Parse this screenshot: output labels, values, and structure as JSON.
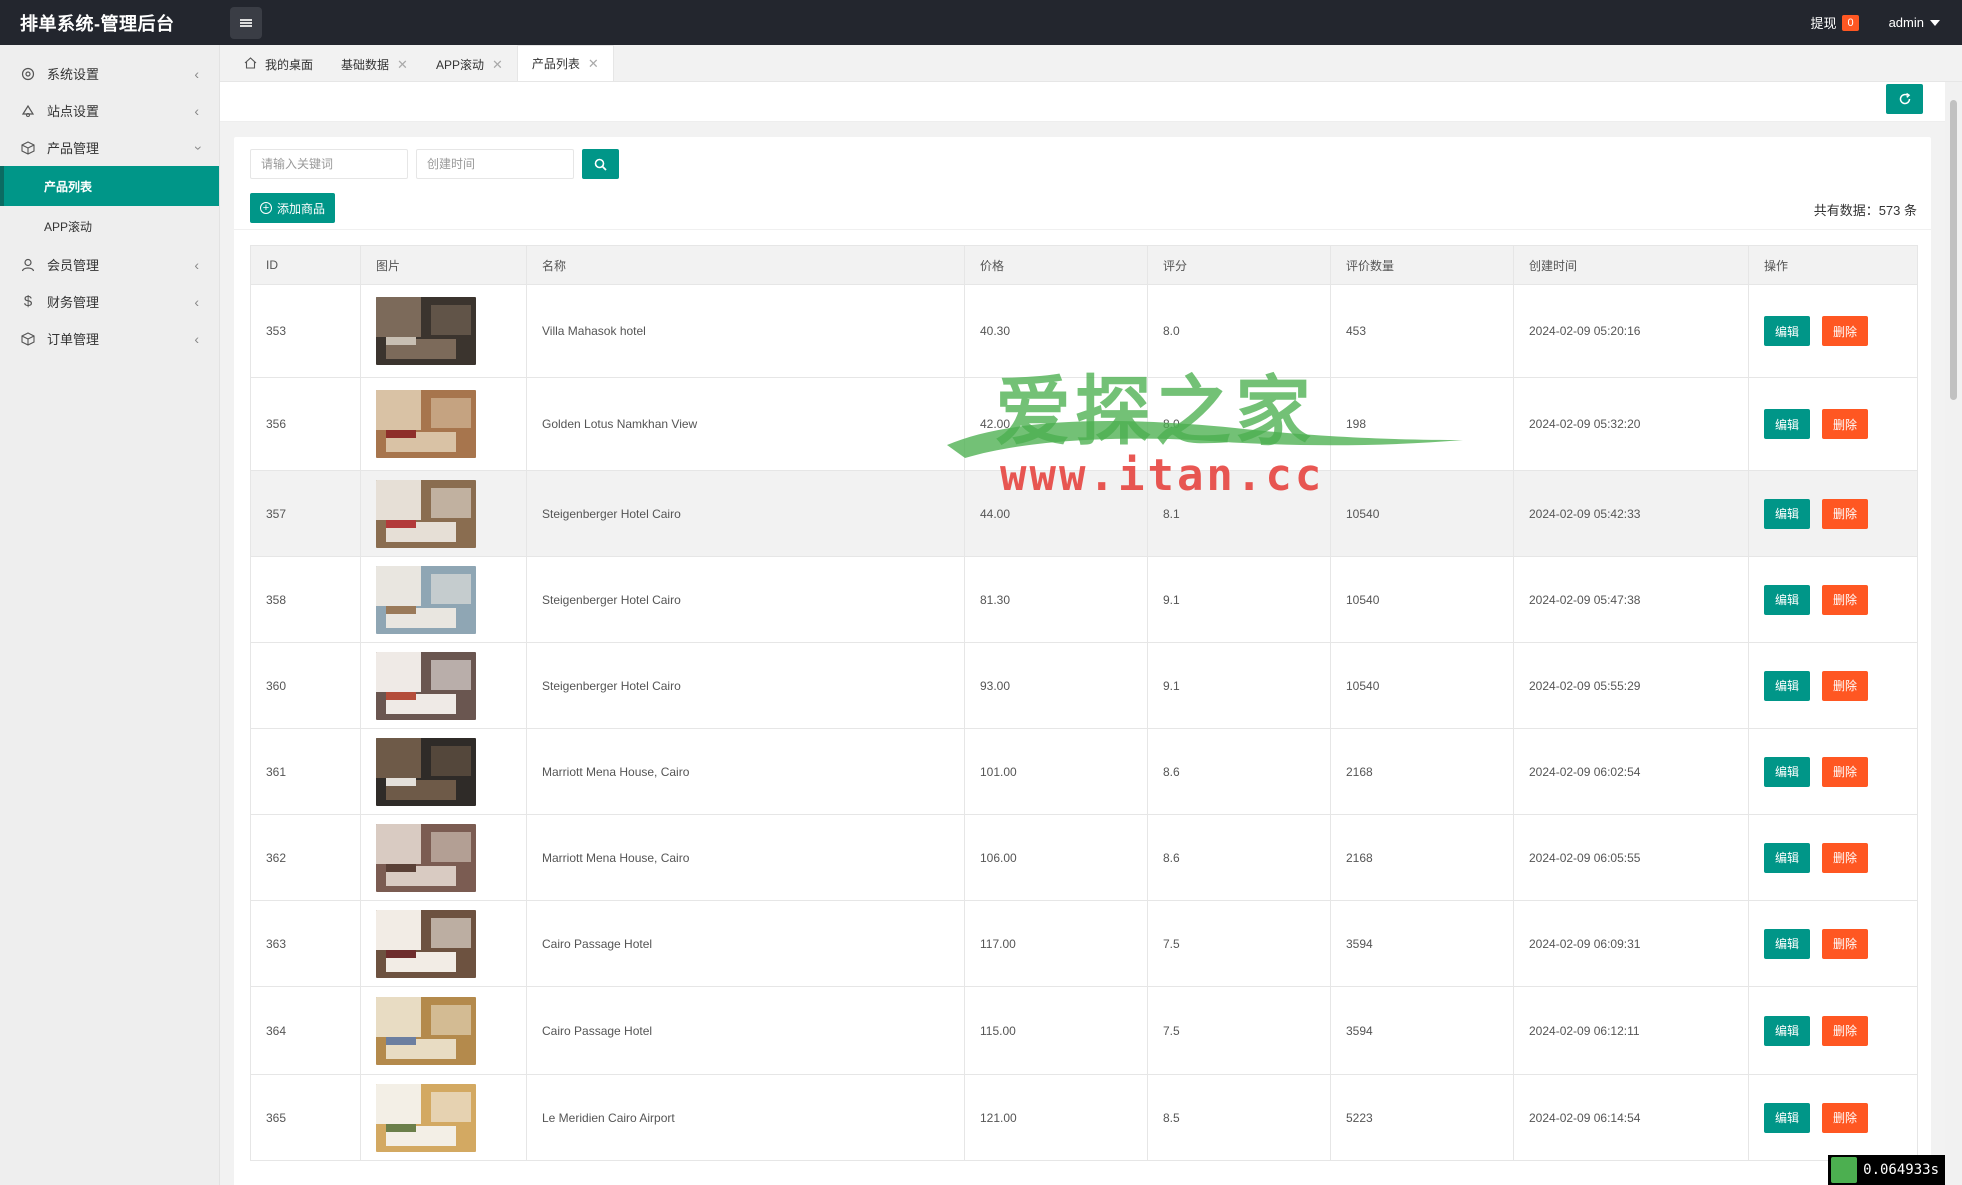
{
  "header": {
    "title": "排单系统-管理后台",
    "withdraw_label": "提现",
    "withdraw_count": "0",
    "user": "admin"
  },
  "sidebar": {
    "items": [
      {
        "label": "系统设置",
        "icon": "gear-icon"
      },
      {
        "label": "站点设置",
        "icon": "site-icon"
      },
      {
        "label": "产品管理",
        "icon": "cube-icon"
      },
      {
        "label": "会员管理",
        "icon": "user-icon"
      },
      {
        "label": "财务管理",
        "icon": "dollar-icon"
      },
      {
        "label": "订单管理",
        "icon": "box-icon"
      }
    ],
    "sub_items": [
      "产品列表",
      "APP滚动"
    ]
  },
  "tabs": [
    {
      "label": "我的桌面"
    },
    {
      "label": "基础数据"
    },
    {
      "label": "APP滚动"
    },
    {
      "label": "产品列表"
    }
  ],
  "search": {
    "keyword_placeholder": "请输入关键词",
    "date_placeholder": "创建时间"
  },
  "actions": {
    "add_label": "添加商品",
    "total_label": "共有数据：573 条",
    "edit_label": "编辑",
    "delete_label": "删除"
  },
  "table": {
    "columns": [
      "ID",
      "图片",
      "名称",
      "价格",
      "评分",
      "评价数量",
      "创建时间",
      "操作"
    ],
    "rows": [
      {
        "id": "353",
        "name": "Villa Mahasok hotel",
        "price": "40.30",
        "score": "8.0",
        "reviews": "453",
        "created": "2024-02-09 05:20:16"
      },
      {
        "id": "356",
        "name": "Golden Lotus Namkhan View",
        "price": "42.00",
        "score": "8.0",
        "reviews": "198",
        "created": "2024-02-09 05:32:20"
      },
      {
        "id": "357",
        "name": "Steigenberger Hotel Cairo",
        "price": "44.00",
        "score": "8.1",
        "reviews": "10540",
        "created": "2024-02-09 05:42:33"
      },
      {
        "id": "358",
        "name": "Steigenberger Hotel Cairo",
        "price": "81.30",
        "score": "9.1",
        "reviews": "10540",
        "created": "2024-02-09 05:47:38"
      },
      {
        "id": "360",
        "name": "Steigenberger Hotel Cairo",
        "price": "93.00",
        "score": "9.1",
        "reviews": "10540",
        "created": "2024-02-09 05:55:29"
      },
      {
        "id": "361",
        "name": "Marriott Mena House, Cairo",
        "price": "101.00",
        "score": "8.6",
        "reviews": "2168",
        "created": "2024-02-09 06:02:54"
      },
      {
        "id": "362",
        "name": "Marriott Mena House, Cairo",
        "price": "106.00",
        "score": "8.6",
        "reviews": "2168",
        "created": "2024-02-09 06:05:55"
      },
      {
        "id": "363",
        "name": "Cairo Passage Hotel",
        "price": "117.00",
        "score": "7.5",
        "reviews": "3594",
        "created": "2024-02-09 06:09:31"
      },
      {
        "id": "364",
        "name": "Cairo Passage Hotel",
        "price": "115.00",
        "score": "7.5",
        "reviews": "3594",
        "created": "2024-02-09 06:12:11"
      },
      {
        "id": "365",
        "name": "Le Meridien Cairo Airport",
        "price": "121.00",
        "score": "8.5",
        "reviews": "5223",
        "created": "2024-02-09 06:14:54"
      }
    ]
  },
  "watermark": {
    "cn": "爱探之家",
    "url": "www.itan.cc"
  },
  "timer": "0.064933s",
  "colors": {
    "primary": "#009688",
    "danger": "#ff5722",
    "header_bg": "#23262e"
  }
}
